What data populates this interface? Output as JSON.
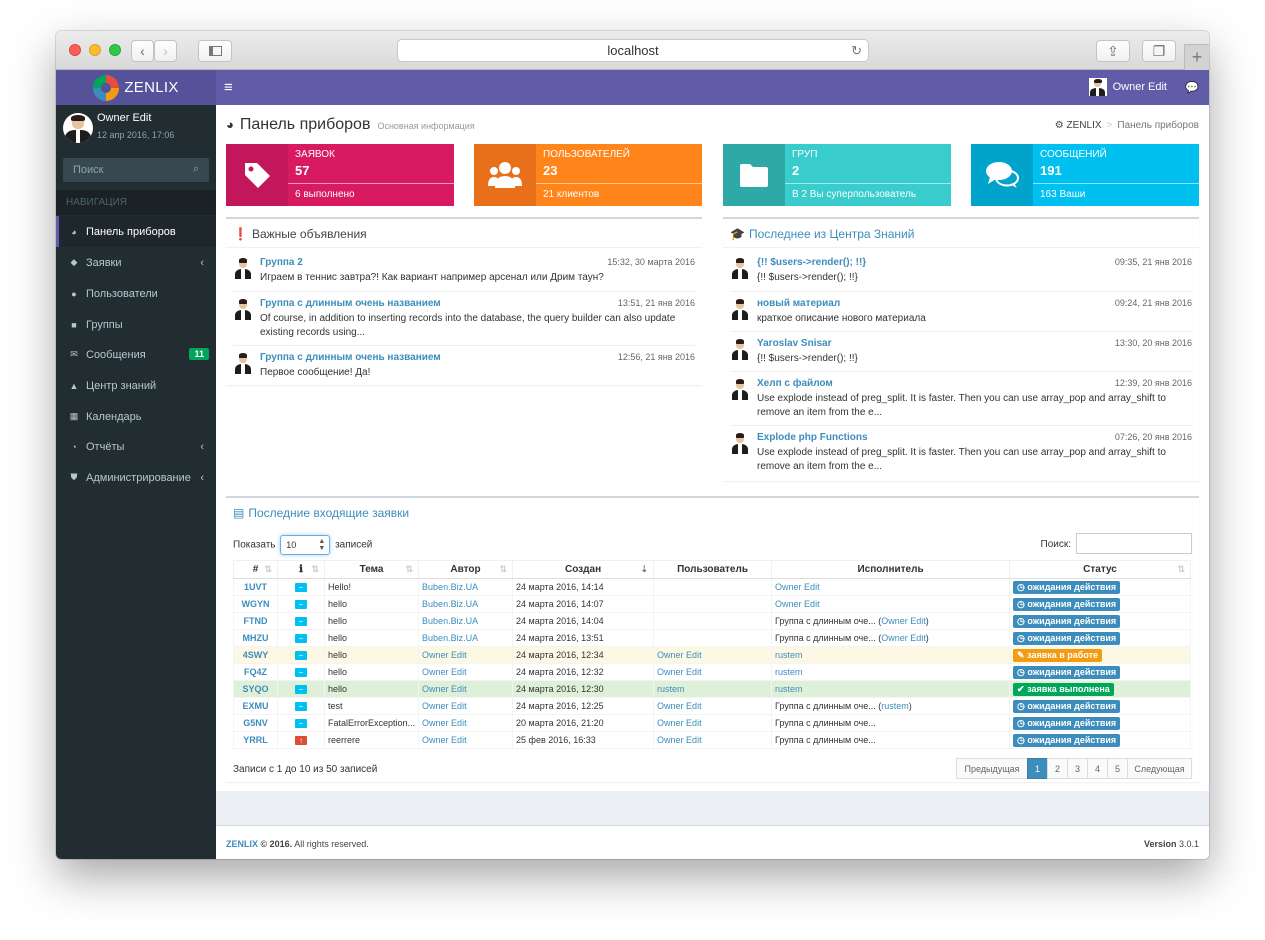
{
  "browser": {
    "url": "localhost"
  },
  "header": {
    "brand": "ZENLIX",
    "user_name": "Owner Edit"
  },
  "sidebar": {
    "user_name": "Owner Edit",
    "user_date": "12 апр 2016, 17:06",
    "search_placeholder": "Поиск",
    "section_label": "НАВИГАЦИЯ",
    "items": [
      {
        "label": "Панель приборов",
        "icon": "dashboard-icon"
      },
      {
        "label": "Заявки",
        "icon": "tag-icon"
      },
      {
        "label": "Пользователи",
        "icon": "users-icon"
      },
      {
        "label": "Группы",
        "icon": "folder-icon"
      },
      {
        "label": "Сообщения",
        "icon": "envelope-icon",
        "badge": "11"
      },
      {
        "label": "Центр знаний",
        "icon": "graduation-cap-icon"
      },
      {
        "label": "Календарь",
        "icon": "calendar-icon"
      },
      {
        "label": "Отчёты",
        "icon": "pie-chart-icon"
      },
      {
        "label": "Администрирование",
        "icon": "shield-icon"
      }
    ]
  },
  "page": {
    "title": "Панель приборов",
    "subtitle": "Основная информация",
    "breadcrumb_home": "ZENLIX",
    "breadcrumb_current": "Панель приборов"
  },
  "stats": [
    {
      "label": "ЗАЯВОК",
      "value": "57",
      "desc": "6 выполнено",
      "color": "#d81b60",
      "color_dark": "#c2185b",
      "icon": "tag-icon"
    },
    {
      "label": "ПОЛЬЗОВАТЕЛЕЙ",
      "value": "23",
      "desc": "21 клиентов",
      "color": "#ff851b",
      "color_dark": "#e8701a",
      "icon": "users-icon"
    },
    {
      "label": "ГРУП",
      "value": "2",
      "desc": "В 2 Вы суперпользователь",
      "color": "#39cccc",
      "color_dark": "#2fa8a8",
      "icon": "folder-icon"
    },
    {
      "label": "СООБЩЕНИЙ",
      "value": "191",
      "desc": "163 Ваши",
      "color": "#00c0ef",
      "color_dark": "#00a3cb",
      "icon": "comments-icon"
    }
  ],
  "announcements": {
    "title": "Важные объявления",
    "items": [
      {
        "title": "Группа 2",
        "time": "15:32, 30 марта 2016",
        "text": "Играем в теннис завтра?! Как вариант например арсенал или Дрим таун?"
      },
      {
        "title": "Группа с длинным очень названием",
        "time": "13:51, 21 янв 2016",
        "text": "Of course, in addition to inserting records into the database, the query builder can also update existing records using..."
      },
      {
        "title": "Группа с длинным очень названием",
        "time": "12:56, 21 янв 2016",
        "text": "Первое сообщение! Да!"
      }
    ]
  },
  "knowledge": {
    "title": "Последнее из Центра Знаний",
    "items": [
      {
        "title": "{!! $users->render(); !!}",
        "time": "09:35, 21 янв 2016",
        "text": "{!! $users->render(); !!}"
      },
      {
        "title": "новый материал",
        "time": "09:24, 21 янв 2016",
        "text": "краткое описание нового материала"
      },
      {
        "title": "Yaroslav Snisar",
        "time": "13:30, 20 янв 2016",
        "text": "{!! $users->render(); !!}"
      },
      {
        "title": "Хелп с файлом",
        "time": "12:39, 20 янв 2016",
        "text": "Use explode instead of preg_split. It is faster. Then you can use array_pop and array_shift to remove an item from the e..."
      },
      {
        "title": "Explode php Functions",
        "time": "07:26, 20 янв 2016",
        "text": "Use explode instead of preg_split. It is faster. Then you can use array_pop and array_shift to remove an item from the e..."
      }
    ]
  },
  "tickets": {
    "title": "Последние входящие заявки",
    "show_label": "Показать",
    "show_value": "10",
    "records_label": "записей",
    "search_label": "Поиск:",
    "columns": [
      "#",
      "Тема",
      "Автор",
      "Создан",
      "Пользователь",
      "Исполнитель",
      "Статус"
    ],
    "rows": [
      {
        "id": "1UVT",
        "prio": "low",
        "subject": "Hello!",
        "author": "Buben.Biz.UA",
        "created": "24 марта 2016, 14:14",
        "user": "",
        "exec": "",
        "exec_link": "Owner Edit",
        "exec_suffix": "",
        "status": "ожидания действия",
        "status_type": "wait",
        "row": ""
      },
      {
        "id": "WGYN",
        "prio": "low",
        "subject": "hello",
        "author": "Buben.Biz.UA",
        "created": "24 марта 2016, 14:07",
        "user": "",
        "exec": "",
        "exec_link": "Owner Edit",
        "exec_suffix": "",
        "status": "ожидания действия",
        "status_type": "wait",
        "row": ""
      },
      {
        "id": "FTND",
        "prio": "low",
        "subject": "hello",
        "author": "Buben.Biz.UA",
        "created": "24 марта 2016, 14:04",
        "user": "",
        "exec": "Группа с длинным оче... (",
        "exec_link": "Owner Edit",
        "exec_suffix": ")",
        "status": "ожидания действия",
        "status_type": "wait",
        "row": ""
      },
      {
        "id": "MHZU",
        "prio": "low",
        "subject": "hello",
        "author": "Buben.Biz.UA",
        "created": "24 марта 2016, 13:51",
        "user": "",
        "exec": "Группа с длинным оче... (",
        "exec_link": "Owner Edit",
        "exec_suffix": ")",
        "status": "ожидания действия",
        "status_type": "wait",
        "row": ""
      },
      {
        "id": "4SWY",
        "prio": "low",
        "subject": "hello",
        "author": "Owner Edit",
        "created": "24 марта 2016, 12:34",
        "user": "Owner Edit",
        "exec": "",
        "exec_link": "rustem",
        "exec_suffix": "",
        "status": "заявка в работе",
        "status_type": "work",
        "row": "warn"
      },
      {
        "id": "FQ4Z",
        "prio": "low",
        "subject": "hello",
        "author": "Owner Edit",
        "created": "24 марта 2016, 12:32",
        "user": "Owner Edit",
        "exec": "",
        "exec_link": "rustem",
        "exec_suffix": "",
        "status": "ожидания действия",
        "status_type": "wait",
        "row": ""
      },
      {
        "id": "SYQO",
        "prio": "low",
        "subject": "hello",
        "author": "Owner Edit",
        "created": "24 марта 2016, 12:30",
        "user": "rustem",
        "exec": "",
        "exec_link": "rustem",
        "exec_suffix": "",
        "status": "заявка выполнена",
        "status_type": "done",
        "row": "ok"
      },
      {
        "id": "EXMU",
        "prio": "low",
        "subject": "test",
        "author": "Owner Edit",
        "created": "24 марта 2016, 12:25",
        "user": "Owner Edit",
        "exec": "Группа с длинным оче... (",
        "exec_link": "rustem",
        "exec_suffix": ")",
        "status": "ожидания действия",
        "status_type": "wait",
        "row": ""
      },
      {
        "id": "G5NV",
        "prio": "low",
        "subject": "FatalErrorException...",
        "author": "Owner Edit",
        "created": "20 марта 2016, 21:20",
        "user": "Owner Edit",
        "exec": "Группа с длинным оче...",
        "exec_link": "",
        "exec_suffix": "",
        "status": "ожидания действия",
        "status_type": "wait",
        "row": ""
      },
      {
        "id": "YRRL",
        "prio": "high",
        "subject": "reerrere",
        "author": "Owner Edit",
        "created": "25 фев 2016, 16:33",
        "user": "Owner Edit",
        "exec": "Группа с длинным оче...",
        "exec_link": "",
        "exec_suffix": "",
        "status": "ожидания действия",
        "status_type": "wait",
        "row": ""
      }
    ],
    "info": "Записи с 1 до 10 из 50 записей",
    "pager": {
      "prev": "Предыдущая",
      "pages": [
        "1",
        "2",
        "3",
        "4",
        "5"
      ],
      "active": "1",
      "next": "Следующая"
    }
  },
  "footer": {
    "brand": "ZENLIX",
    "copy": "© 2016.",
    "rights": "All rights reserved.",
    "version_label": "Version",
    "version": "3.0.1"
  }
}
